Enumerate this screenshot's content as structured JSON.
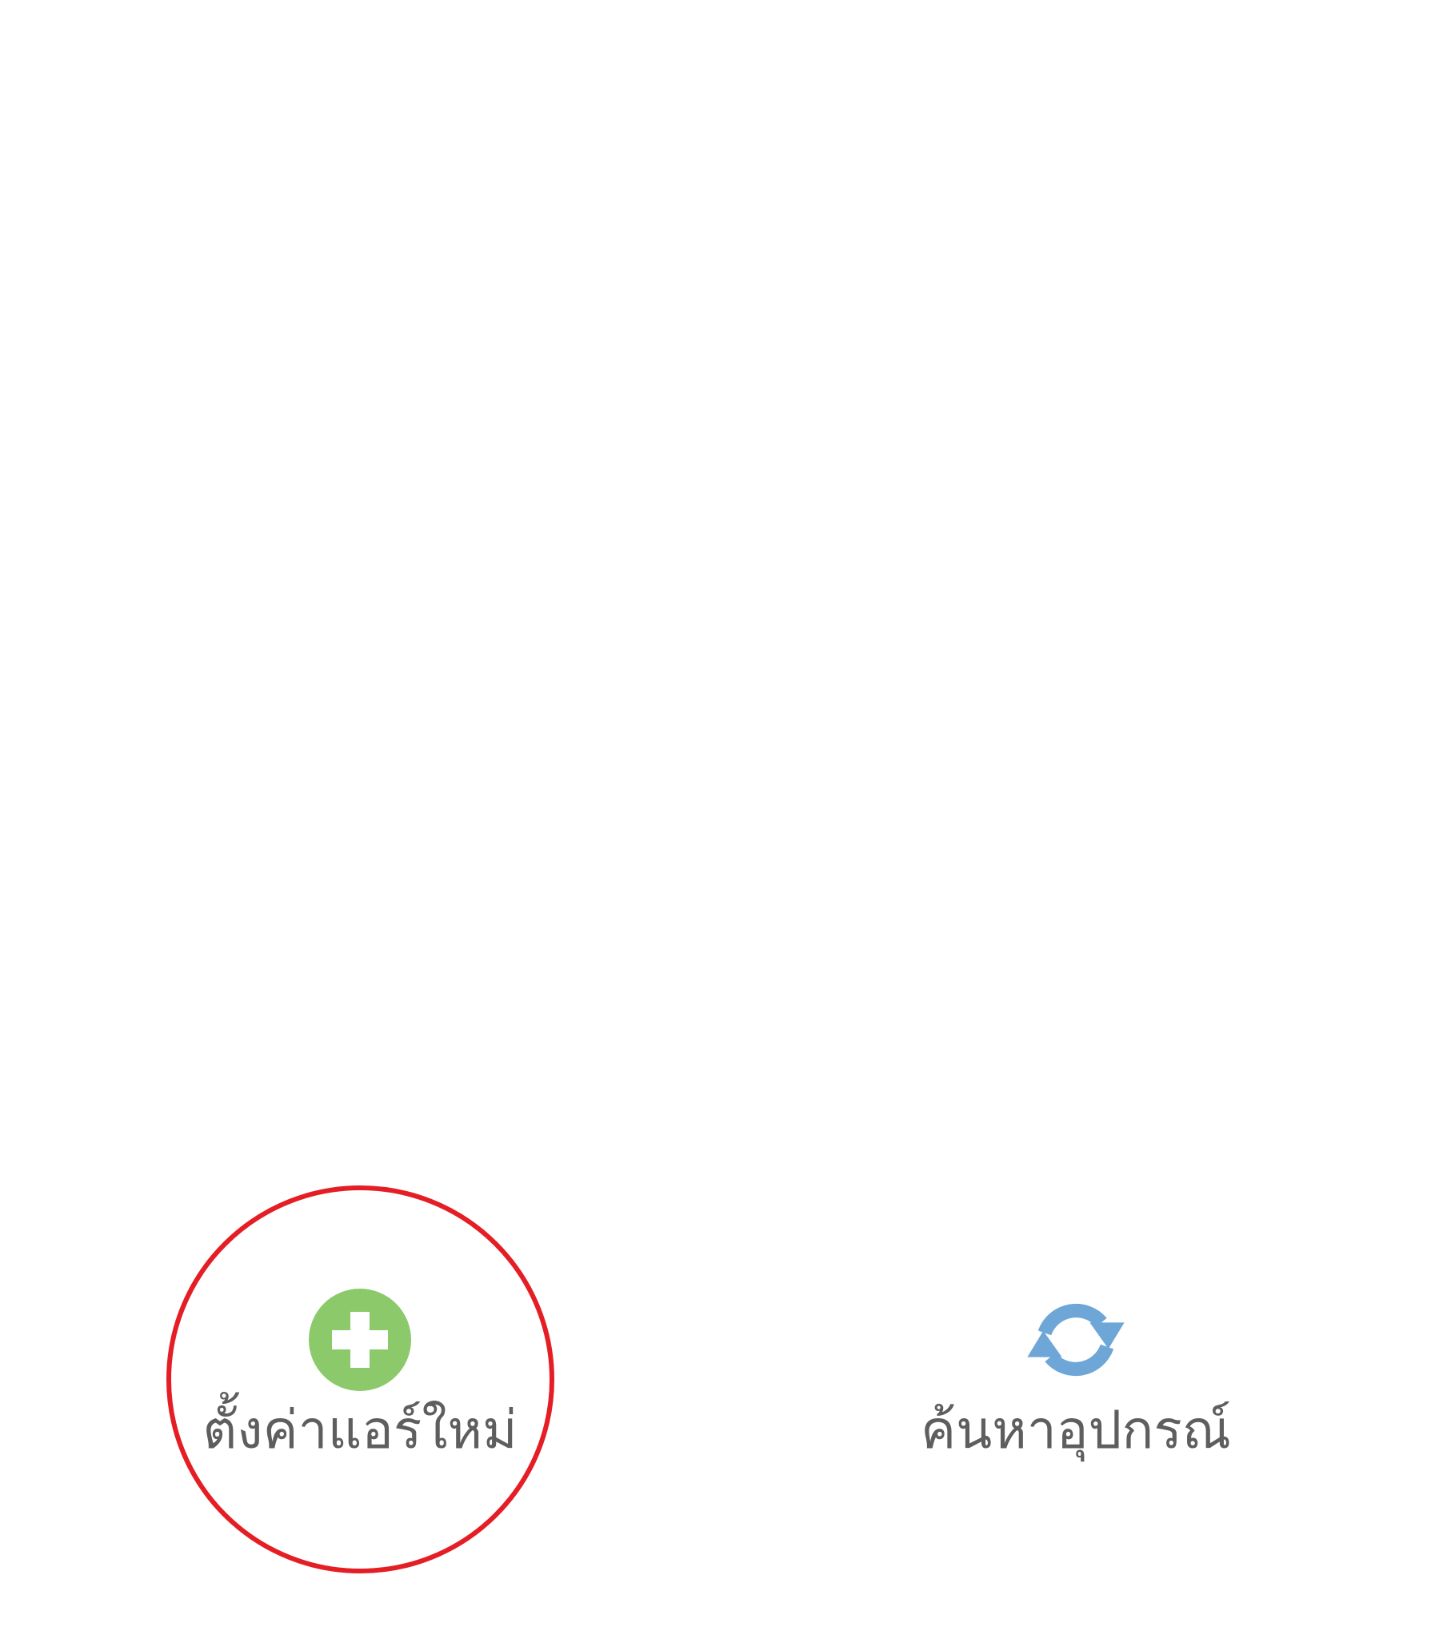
{
  "actions": {
    "add_aircon": {
      "label": "ตั้งค่าแอร์ใหม่",
      "icon": "plus-circle-icon",
      "icon_color": "#8cc96b"
    },
    "search_device": {
      "label": "ค้นหาอุปกรณ์",
      "icon": "refresh-icon",
      "icon_color": "#6fa6d8"
    }
  },
  "annotation": {
    "highlight_color": "#e41e24"
  }
}
